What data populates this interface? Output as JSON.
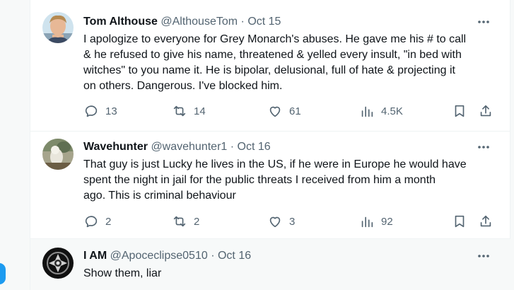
{
  "tweets": [
    {
      "name": "Tom Althouse",
      "handle": "@AlthouseTom",
      "separator": "·",
      "date": "Oct 15",
      "lines": [
        "I apologize to everyone for Grey Monarch's abuses. He gave me his # to call",
        "& he refused to give his name, threatened & yelled every insult, \"in bed with",
        "witches\" to you name it. He is bipolar, delusional, full of hate & projecting it",
        "on others. Dangerous. I've blocked him."
      ],
      "replies": "13",
      "reposts": "14",
      "likes": "61",
      "views": "4.5K"
    },
    {
      "name": "Wavehunter",
      "handle": "@wavehunter1",
      "separator": "·",
      "date": "Oct 16",
      "lines": [
        "That guy is just Lucky he lives in the US, if he were in Europe he would have",
        "spent the night in jail for the public threats I received from him a month",
        "ago. This is criminal behaviour"
      ],
      "replies": "2",
      "reposts": "2",
      "likes": "3",
      "views": "92"
    },
    {
      "name": "I AM",
      "handle": "@Apoceclipse0510",
      "separator": "·",
      "date": "Oct 16",
      "lines": [
        "Show them, liar"
      ]
    }
  ],
  "icons": {
    "more": "more-dots-icon",
    "reply": "reply-icon",
    "repost": "repost-icon",
    "like": "heart-icon",
    "views": "views-chart-icon",
    "bookmark": "bookmark-icon",
    "share": "share-icon"
  },
  "colors": {
    "text": "#0f1419",
    "secondary": "#536471",
    "accent": "#1d9bf0",
    "divider": "#eff3f4",
    "hover_bg": "#f7f9f9"
  }
}
